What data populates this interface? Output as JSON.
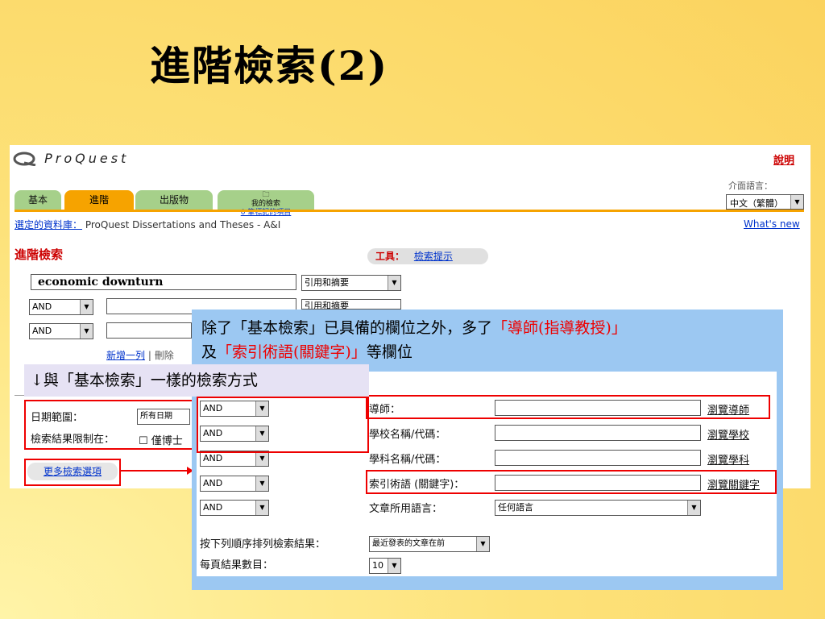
{
  "slide": {
    "title": "進階檢索(2)"
  },
  "app": {
    "logo": "ProQuest",
    "help": "說明",
    "lang_label": "介面語言：",
    "lang_value": "中文（繁體）",
    "tabs": {
      "basic": "基本",
      "advanced": "進階",
      "publications": "出版物",
      "my_search": "我的檢索",
      "marked_items": "0 筆標記的項目"
    },
    "db_label": "選定的資料庫：",
    "db_value": "ProQuest Dissertations and Theses - A&I",
    "whats_new": "What's new",
    "heading": "進階檢索",
    "tools_label": "工具：",
    "tools_link": "檢索提示",
    "query_value": "economic downturn",
    "field_select": "引用和摘要",
    "field_select_2": "引用和摘要",
    "op_and": "AND",
    "add_row": "新增一列",
    "sep": "|",
    "delete_row": "刪除",
    "date_range_label": "日期範圍：",
    "date_range_value": "所有日期",
    "limit_label": "檢索結果限制在：",
    "limit_checkbox": "☐ 僅博士",
    "more_options": "更多檢索選項"
  },
  "callout": {
    "line1_a": "除了「基本檢索」已具備的欄位之外，多了",
    "line1_b": "「導師(指導教授)」",
    "line2_a": "及",
    "line2_b": "「索引術語(關鍵字)」",
    "line2_c": "等欄位",
    "same_note": "↓與「基本檢索」一樣的檢索方式"
  },
  "extra_fields": {
    "advisor_label": "導師：",
    "advisor_link": "瀏覽導師",
    "school_label": "學校名稱/代碼：",
    "school_link": "瀏覽學校",
    "subject_label": "學科名稱/代碼：",
    "subject_link": "瀏覽學科",
    "index_label": "索引術語 (關鍵字)：",
    "index_link": "瀏覽關鍵字",
    "language_label": "文章所用語言：",
    "language_value": "任何語言",
    "sort_label": "按下列順序排列檢索結果：",
    "sort_value": "最近發表的文章在前",
    "per_page_label": "每頁結果數目：",
    "per_page_value": "10",
    "op_and": "AND"
  }
}
